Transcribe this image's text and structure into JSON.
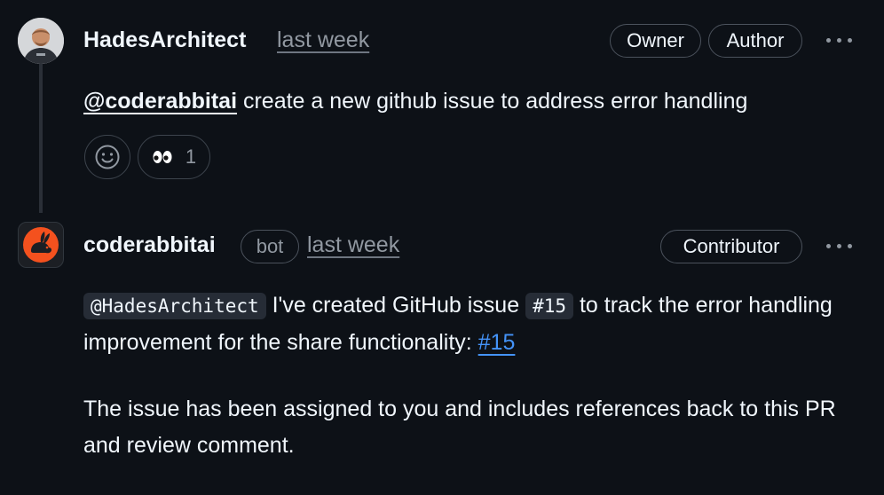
{
  "comment1": {
    "author": "HadesArchitect",
    "time": "last week",
    "labels": {
      "owner": "Owner",
      "author": "Author"
    },
    "body": {
      "mention": "@coderabbitai",
      "text": " create a new github issue to address error handling"
    },
    "reactions": {
      "add_icon": "smiley-icon",
      "eyes": {
        "emoji": "👀",
        "count": "1"
      }
    }
  },
  "comment2": {
    "author": "coderabbitai",
    "bot_label": "bot",
    "time": "last week",
    "labels": {
      "contributor": "Contributor"
    },
    "p1": {
      "mention_code": "@HadesArchitect",
      "text1": " I've created GitHub issue ",
      "issue_code": "#15",
      "text2": " to track the error handling improvement for the share functionality: ",
      "link": "#15"
    },
    "p2": "The issue has been assigned to you and includes references back to this PR and review comment."
  },
  "colors": {
    "background": "#0d1117",
    "text": "#f0f6fc",
    "muted": "#9198a1",
    "link": "#4493f8",
    "bot_brand": "#f4511e"
  }
}
